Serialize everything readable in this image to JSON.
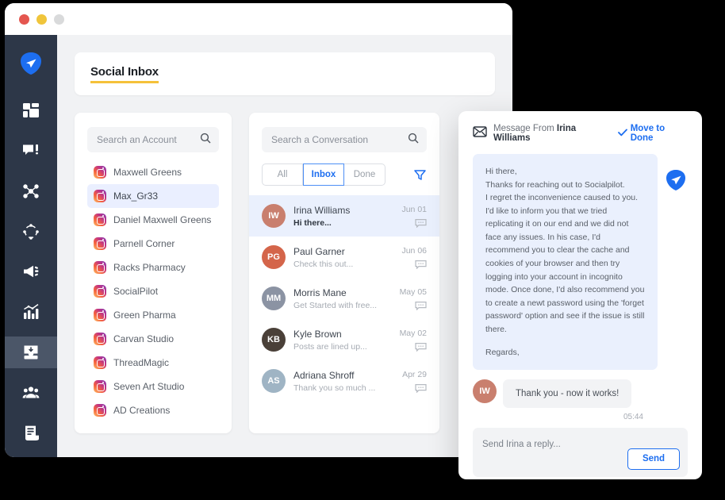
{
  "window": {
    "traffic_lights": [
      {
        "name": "close",
        "color": "#e4564f"
      },
      {
        "name": "minimize",
        "color": "#f0c53b"
      },
      {
        "name": "maximize",
        "color": "#d9dadb"
      }
    ]
  },
  "sidebar": {
    "items": [
      {
        "icon": "paper-plane-logo-icon",
        "label": "SocialPilot",
        "active": false
      },
      {
        "icon": "dashboard-grid-icon",
        "label": "Dashboard",
        "active": false
      },
      {
        "icon": "compose-message-icon",
        "label": "Compose",
        "active": false
      },
      {
        "icon": "network-share-icon",
        "label": "Content",
        "active": false
      },
      {
        "icon": "sync-circle-icon",
        "label": "Curate",
        "active": false
      },
      {
        "icon": "megaphone-icon",
        "label": "Advertise",
        "active": false
      },
      {
        "icon": "analytics-chart-icon",
        "label": "Analytics",
        "active": false
      },
      {
        "icon": "inbox-tray-icon",
        "label": "Social Inbox",
        "active": true
      },
      {
        "icon": "team-people-icon",
        "label": "Team",
        "active": false
      },
      {
        "icon": "report-document-icon",
        "label": "Reports",
        "active": false
      }
    ]
  },
  "header": {
    "title": "Social Inbox",
    "underline_color": "#f5c13a"
  },
  "accounts_panel": {
    "search": {
      "placeholder": "Search an Account",
      "value": "",
      "icon": "search-icon"
    },
    "items": [
      {
        "name": "Maxwell Greens",
        "network": "instagram",
        "selected": false
      },
      {
        "name": "Max_Gr33",
        "network": "instagram",
        "selected": true
      },
      {
        "name": "Daniel Maxwell Greens",
        "network": "instagram",
        "selected": false
      },
      {
        "name": "Parnell Corner",
        "network": "instagram",
        "selected": false
      },
      {
        "name": "Racks Pharmacy",
        "network": "instagram",
        "selected": false
      },
      {
        "name": "SocialPilot",
        "network": "instagram",
        "selected": false
      },
      {
        "name": "Green Pharma",
        "network": "instagram",
        "selected": false
      },
      {
        "name": "Carvan Studio",
        "network": "instagram",
        "selected": false
      },
      {
        "name": "ThreadMagic",
        "network": "instagram",
        "selected": false
      },
      {
        "name": "Seven Art Studio",
        "network": "instagram",
        "selected": false
      },
      {
        "name": "AD Creations",
        "network": "instagram",
        "selected": false
      }
    ]
  },
  "conversations_panel": {
    "search": {
      "placeholder": "Search a Conversation",
      "value": "",
      "icon": "search-icon"
    },
    "tabs": [
      {
        "label": "All",
        "active": false
      },
      {
        "label": "Inbox",
        "active": true
      },
      {
        "label": "Done",
        "active": false
      }
    ],
    "filter_icon": "filter-funnel-icon",
    "active_tab_color": "#1d6ef0",
    "items": [
      {
        "name": "Irina Williams",
        "preview": "Hi there...",
        "date": "Jun 01",
        "selected": true,
        "initials": "IW",
        "avatar_color": "#c97f6e"
      },
      {
        "name": "Paul Garner",
        "preview": "Check this out...",
        "date": "Jun 06",
        "selected": false,
        "initials": "PG",
        "avatar_color": "#d4654a"
      },
      {
        "name": "Morris Mane",
        "preview": "Get Started with free...",
        "date": "May 05",
        "selected": false,
        "initials": "MM",
        "avatar_color": "#8b93a3"
      },
      {
        "name": "Kyle Brown",
        "preview": "Posts are lined up...",
        "date": "May 02",
        "selected": false,
        "initials": "KB",
        "avatar_color": "#4a4038"
      },
      {
        "name": "Adriana Shroff",
        "preview": "Thank you so much ...",
        "date": "Apr 29",
        "selected": false,
        "initials": "AS",
        "avatar_color": "#9fb4c4"
      }
    ]
  },
  "message_panel": {
    "envelope_icon": "envelope-icon",
    "from_prefix": "Message From ",
    "from_name": "Irina Williams",
    "move_to_done": {
      "label": "Move to Done",
      "icon": "check-icon",
      "color": "#1d6ef0"
    },
    "incoming": {
      "paragraphs": [
        "Hi there,",
        "Thanks for reaching out to Socialpilot.",
        "I regret the inconvenience caused to you. I'd like to inform you that we tried replicating it on our end and we did not face any issues. In his case, I'd recommend you to clear the cache and cookies of your browser and then try logging into your account in incognito mode. Once done, I'd also recommend you to create a newt password using the 'forget password' option and see if the issue is still there.",
        "Regards,"
      ],
      "badge_icon": "paper-plane-badge-icon"
    },
    "reply": {
      "text": "Thank you - now it works!",
      "timestamp": "05:44",
      "initials": "IW",
      "avatar_color": "#c97f6e"
    },
    "composer": {
      "placeholder": "Send Irina a reply...",
      "value": "",
      "send_label": "Send"
    }
  }
}
